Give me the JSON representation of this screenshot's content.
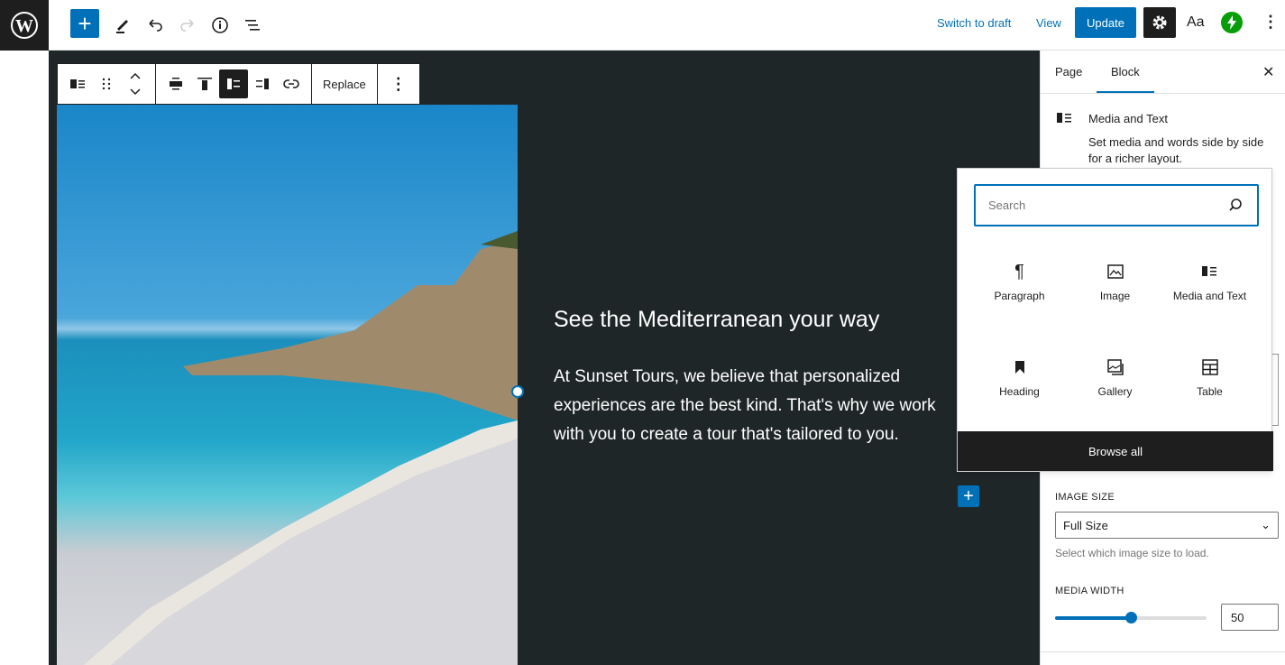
{
  "topbar": {
    "switch_draft": "Switch to draft",
    "view": "View",
    "update": "Update",
    "styles": "Aa"
  },
  "toolbar": {
    "replace": "Replace"
  },
  "content": {
    "heading": "See the Mediterranean your way",
    "paragraph": "At Sunset Tours, we believe that personalized experiences are the best kind. That's why we work with you to create a tour that's tailored to you."
  },
  "sidebar": {
    "tabs": [
      "Page",
      "Block"
    ],
    "active_tab": "Block",
    "block_title": "Media and Text",
    "block_desc": "Set media and words side by side for a richer layout.",
    "image_size_label": "IMAGE SIZE",
    "image_size_value": "Full Size",
    "image_size_help": "Select which image size to load.",
    "media_width_label": "MEDIA WIDTH",
    "media_width_value": "50"
  },
  "inserter": {
    "search_placeholder": "Search",
    "blocks": [
      {
        "label": "Paragraph",
        "icon": "paragraph-icon"
      },
      {
        "label": "Image",
        "icon": "image-icon"
      },
      {
        "label": "Media and Text",
        "icon": "media-text-icon"
      },
      {
        "label": "Heading",
        "icon": "bookmark-icon"
      },
      {
        "label": "Gallery",
        "icon": "gallery-icon"
      },
      {
        "label": "Table",
        "icon": "table-icon"
      }
    ],
    "browse_all": "Browse all"
  },
  "colors": {
    "accent": "#0071b9",
    "canvas": "#1f2628",
    "dark": "#1e1e1e",
    "jetpack": "#069e08"
  }
}
